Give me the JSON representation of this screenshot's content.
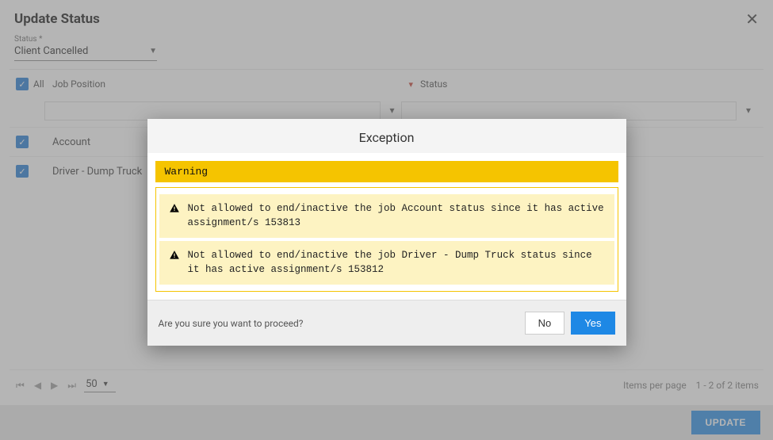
{
  "header": {
    "title": "Update Status"
  },
  "status_field": {
    "label": "Status *",
    "value": "Client Cancelled"
  },
  "grid": {
    "select_all_label": "All",
    "columns": {
      "job": "Job Position",
      "status": "Status"
    },
    "rows": [
      {
        "job": "Account"
      },
      {
        "job": "Driver - Dump Truck"
      }
    ]
  },
  "pager": {
    "page_size": "50",
    "items_per_page_label": "Items per page",
    "range": "1 - 2 of 2 items"
  },
  "footer": {
    "update": "UPDATE"
  },
  "modal": {
    "title": "Exception",
    "warning_head": "Warning",
    "warnings": [
      "Not allowed to end/inactive the job Account status since it has active assignment/s 153813",
      "Not allowed to end/inactive the job Driver - Dump Truck status since it has active assignment/s 153812"
    ],
    "prompt": "Are you sure you want to proceed?",
    "no": "No",
    "yes": "Yes"
  }
}
